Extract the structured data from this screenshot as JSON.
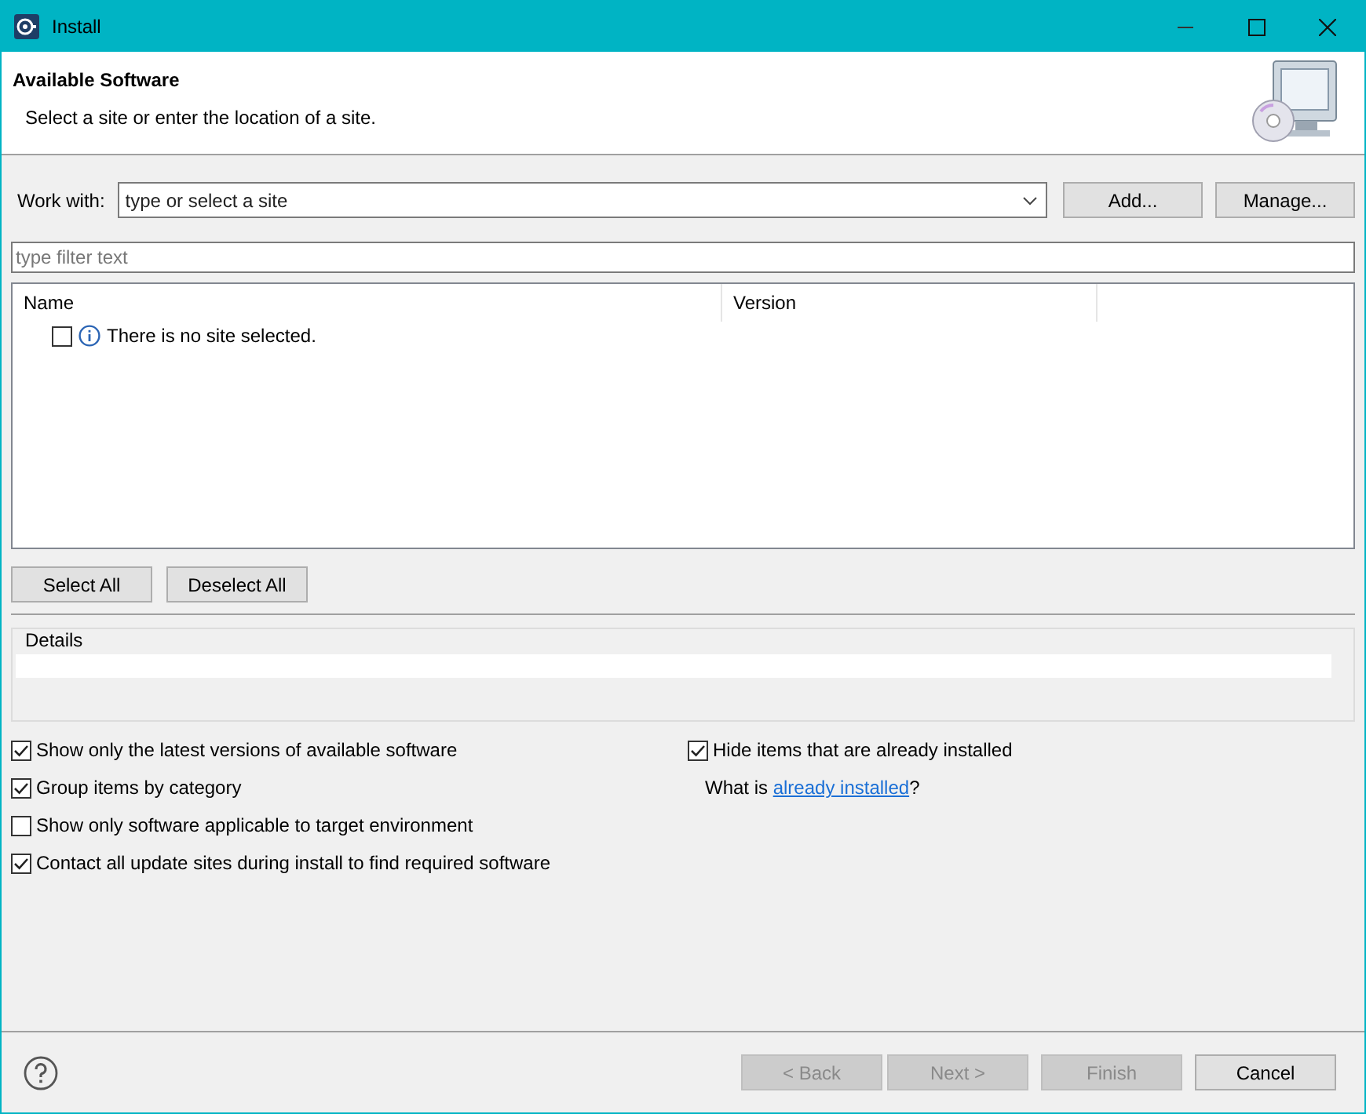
{
  "window": {
    "title": "Install"
  },
  "header": {
    "title": "Available Software",
    "subtitle": "Select a site or enter the location of a site."
  },
  "work_with": {
    "label": "Work with:",
    "placeholder": "type or select a site",
    "buttons": [
      {
        "label": "Add..."
      },
      {
        "label": "Manage..."
      }
    ]
  },
  "filter": {
    "placeholder": "type filter text"
  },
  "table": {
    "columns": [
      "Name",
      "Version"
    ],
    "rows": [
      {
        "checked": false,
        "text": "There is no site selected."
      }
    ]
  },
  "selection_buttons": [
    {
      "label": "Select All"
    },
    {
      "label": "Deselect All"
    }
  ],
  "details": {
    "label": "Details"
  },
  "options_left": [
    {
      "label": "Show only the latest versions of available software",
      "checked": true
    },
    {
      "label": "Group items by category",
      "checked": true
    },
    {
      "label": "Show only software applicable to target environment",
      "checked": false
    },
    {
      "label": "Contact all update sites during install to find required software",
      "checked": true
    }
  ],
  "options_right": [
    {
      "label": "Hide items that are already installed",
      "checked": true
    }
  ],
  "installed_note": {
    "before": "What is ",
    "link": "already installed",
    "after": "?"
  },
  "footer_buttons": [
    {
      "label": "< Back",
      "disabled": true
    },
    {
      "label": "Next >",
      "disabled": true
    },
    {
      "label": "Finish",
      "disabled": true
    },
    {
      "label": "Cancel",
      "disabled": false
    }
  ]
}
